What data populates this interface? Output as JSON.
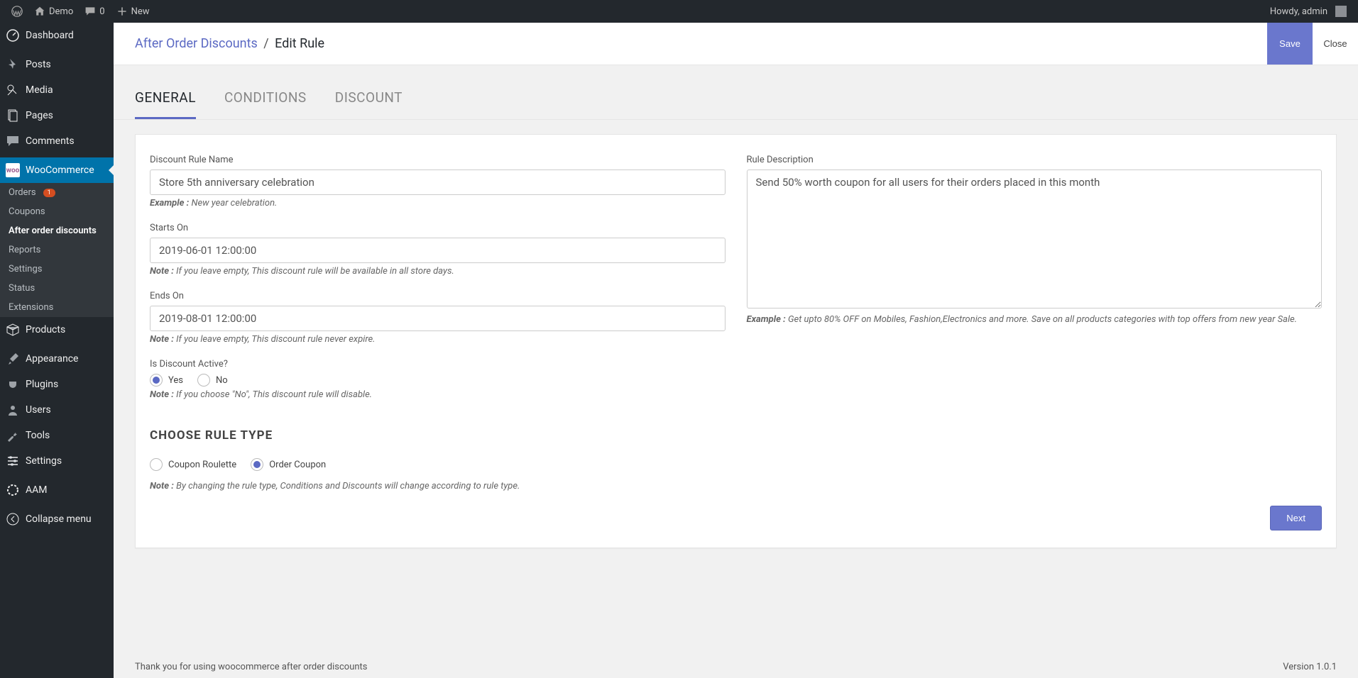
{
  "adminbar": {
    "site_name": "Demo",
    "comments_count": "0",
    "new_label": "New",
    "howdy": "Howdy, admin"
  },
  "sidebar": {
    "items": [
      {
        "label": "Dashboard",
        "icon": "dashboard"
      },
      {
        "label": "Posts",
        "icon": "pin"
      },
      {
        "label": "Media",
        "icon": "media"
      },
      {
        "label": "Pages",
        "icon": "page"
      },
      {
        "label": "Comments",
        "icon": "comment"
      },
      {
        "label": "WooCommerce",
        "icon": "woo",
        "active": true
      },
      {
        "label": "Products",
        "icon": "box"
      },
      {
        "label": "Appearance",
        "icon": "brush"
      },
      {
        "label": "Plugins",
        "icon": "plug"
      },
      {
        "label": "Users",
        "icon": "user"
      },
      {
        "label": "Tools",
        "icon": "wrench"
      },
      {
        "label": "Settings",
        "icon": "sliders"
      },
      {
        "label": "AAM",
        "icon": "shield"
      },
      {
        "label": "Collapse menu",
        "icon": "collapse"
      }
    ],
    "woo_submenu": [
      {
        "label": "Orders",
        "badge": "1"
      },
      {
        "label": "Coupons"
      },
      {
        "label": "After order discounts",
        "active": true
      },
      {
        "label": "Reports"
      },
      {
        "label": "Settings"
      },
      {
        "label": "Status"
      },
      {
        "label": "Extensions"
      }
    ]
  },
  "breadcrumb": {
    "parent": "After Order Discounts",
    "current": "Edit Rule"
  },
  "header_actions": {
    "save": "Save",
    "close": "Close"
  },
  "tabs": [
    {
      "label": "GENERAL",
      "active": true
    },
    {
      "label": "CONDITIONS"
    },
    {
      "label": "DISCOUNT"
    }
  ],
  "form": {
    "rule_name": {
      "label": "Discount Rule Name",
      "value": "Store 5th anniversary celebration",
      "hint_prefix": "Example :",
      "hint_text": " New year celebration."
    },
    "starts_on": {
      "label": "Starts On",
      "value": "2019-06-01 12:00:00",
      "hint_prefix": "Note :",
      "hint_text": " If you leave empty, This discount rule will be available in all store days."
    },
    "ends_on": {
      "label": "Ends On",
      "value": "2019-08-01 12:00:00",
      "hint_prefix": "Note :",
      "hint_text": " If you leave empty, This discount rule never expire."
    },
    "is_active": {
      "label": "Is Discount Active?",
      "yes": "Yes",
      "no": "No",
      "hint_prefix": "Note :",
      "hint_text": " If you choose \"No\", This discount rule will disable."
    },
    "description": {
      "label": "Rule Description",
      "value": "Send 50% worth coupon for all users for their orders placed in this month",
      "hint_prefix": "Example :",
      "hint_text": " Get upto 80% OFF on Mobiles, Fashion,Electronics and more. Save on all products categories with top offers from new year Sale."
    },
    "rule_type": {
      "title": "CHOOSE RULE TYPE",
      "coupon_roulette": "Coupon Roulette",
      "order_coupon": "Order Coupon",
      "hint_prefix": "Note :",
      "hint_text": " By changing the rule type, Conditions and Discounts will change according to rule type."
    },
    "next": "Next"
  },
  "footer": {
    "thanks": "Thank you for using woocommerce after order discounts",
    "version": "Version 1.0.1"
  }
}
